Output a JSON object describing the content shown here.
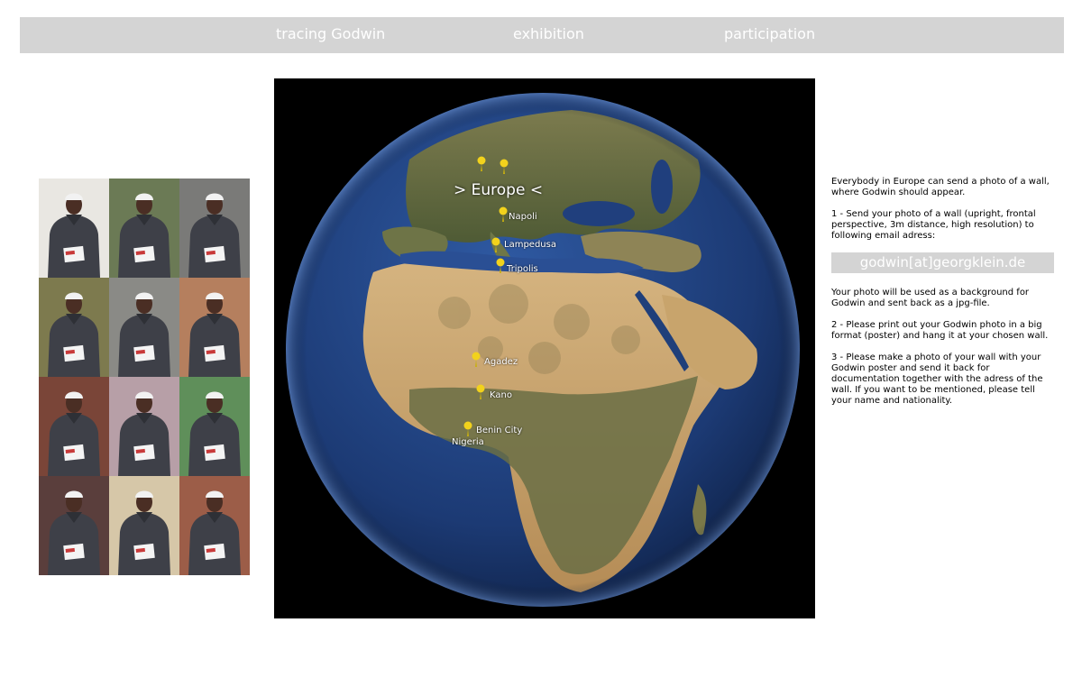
{
  "nav": {
    "items": [
      "tracing Godwin",
      "exhibition",
      "participation"
    ]
  },
  "gallery": {
    "tile_count": 12,
    "backgrounds": [
      "#e9e7e2",
      "#6b7a55",
      "#7a7a78",
      "#7d7a4e",
      "#8a8a86",
      "#b57f5e",
      "#7a4538",
      "#b79fa7",
      "#5f8f5a",
      "#5a3e3c",
      "#d6c7a8",
      "#9c5d48"
    ]
  },
  "map": {
    "region_label": "> Europe <",
    "places": [
      "Napoli",
      "Lampedusa",
      "Tripolis",
      "Agadez",
      "Kano",
      "Benin City",
      "Nigeria"
    ]
  },
  "info": {
    "intro": "Everybody in Europe can send a photo of a wall, where Godwin should appear.",
    "step1": "1 - Send your photo of a wall (upright, frontal perspective, 3m distance, high resolution) to following email adress:",
    "email": "godwin[at]georgklein.de",
    "note": "Your photo will be used as a background for Godwin and sent back as a jpg-file.",
    "step2": "2 - Please print out your Godwin photo in a big format (poster) and hang it at your chosen wall.",
    "step3": "3 - Please make a photo of your wall with your Godwin poster and send it back for documentation together with the adress of the wall. If you want to be mentioned, please tell your name and nationality."
  },
  "colors": {
    "nav_bg": "#d4d4d4",
    "pin": "#f2d21c",
    "ocean": "#1f3f7a",
    "land": "#c9a56b"
  }
}
